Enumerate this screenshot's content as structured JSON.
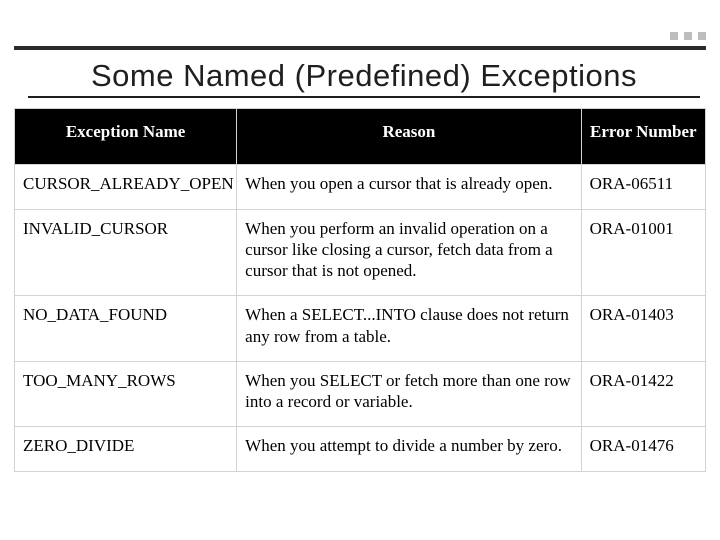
{
  "title": "Some Named (Predefined) Exceptions",
  "headers": {
    "name": "Exception Name",
    "reason": "Reason",
    "error": "Error Number"
  },
  "rows": [
    {
      "name": "CURSOR_ALREADY_OPEN",
      "reason": "When you open a cursor that is already open.",
      "error": "ORA-06511"
    },
    {
      "name": "INVALID_CURSOR",
      "reason": "When you perform an invalid operation on a cursor like closing a cursor, fetch data from a cursor that is not opened.",
      "error": "ORA-01001"
    },
    {
      "name": "NO_DATA_FOUND",
      "reason": "When a SELECT...INTO clause does not return any row from a table.",
      "error": "ORA-01403"
    },
    {
      "name": "TOO_MANY_ROWS",
      "reason": "When you SELECT or fetch more than one row into a record or variable.",
      "error": "ORA-01422"
    },
    {
      "name": "ZERO_DIVIDE",
      "reason": "When you attempt to divide a number by zero.",
      "error": "ORA-01476"
    }
  ]
}
